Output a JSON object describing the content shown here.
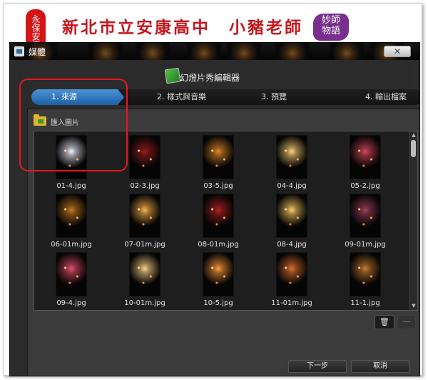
{
  "banner": {
    "seal_text": "永保安康",
    "headline_left": "新北市立安康高中",
    "headline_right": "小豬老師",
    "badge_lines": [
      "妙師",
      "物語"
    ]
  },
  "window": {
    "title": "媒體",
    "close_label": "✕",
    "app_title": "幻燈片秀編輯器",
    "steps": [
      {
        "label": "1. 來源"
      },
      {
        "label": "2. 樣式與音樂"
      },
      {
        "label": "3. 預覽"
      },
      {
        "label": "4. 輸出檔案"
      }
    ],
    "import_label": "匯入圖片",
    "thumbnails": [
      {
        "caption": "01-4.jpg",
        "color": "#f2f2ff"
      },
      {
        "caption": "02-3.jpg",
        "color": "#9a1c1c"
      },
      {
        "caption": "03-5.jpg",
        "color": "#e08a2a"
      },
      {
        "caption": "04-4.jpg",
        "color": "#ffd27a"
      },
      {
        "caption": "05-2.jpg",
        "color": "#d8485a"
      },
      {
        "caption": "06-01m.jpg",
        "color": "#c87a20"
      },
      {
        "caption": "07-01m.jpg",
        "color": "#ffb24a"
      },
      {
        "caption": "08-01m.jpg",
        "color": "#b02020"
      },
      {
        "caption": "08-4.jpg",
        "color": "#ffcc66"
      },
      {
        "caption": "09-01m.jpg",
        "color": "#a0405a"
      },
      {
        "caption": "09-4.jpg",
        "color": "#e8506a"
      },
      {
        "caption": "10-01m.jpg",
        "color": "#ffd48a"
      },
      {
        "caption": "10-5.jpg",
        "color": "#ff9a3a"
      },
      {
        "caption": "11-01m.jpg",
        "color": "#e07030"
      },
      {
        "caption": "11-1.jpg",
        "color": "#c87a30"
      }
    ],
    "delete_icon": "🗑",
    "minus_label": "—",
    "next_label": "下一步",
    "cancel_label": "取消"
  }
}
